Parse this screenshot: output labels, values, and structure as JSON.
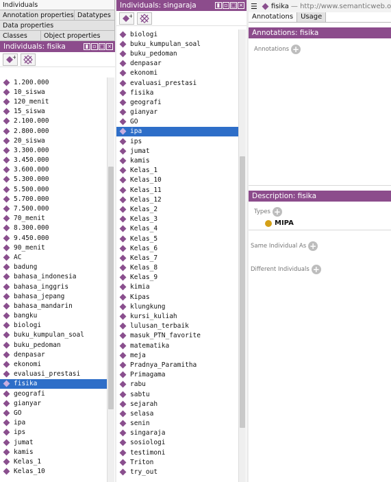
{
  "left_panel": {
    "tabs_row1": [
      "Individuals"
    ],
    "tabs_row2": [
      "Annotation properties",
      "Datatypes"
    ],
    "tabs_row3": [
      "Data properties"
    ],
    "tabs_row4": [
      "Classes",
      "Object properties"
    ],
    "header": "Individuals: fisika",
    "items": [
      "1.200.000",
      "10_siswa",
      "120_menit",
      "15_siswa",
      "2.100.000",
      "2.800.000",
      "20_siswa",
      "3.300.000",
      "3.450.000",
      "3.600.000",
      "5.300.000",
      "5.500.000",
      "5.700.000",
      "7.500.000",
      "70_menit",
      "8.300.000",
      "9.450.000",
      "90_menit",
      "AC",
      "badung",
      "bahasa_indonesia",
      "bahasa_inggris",
      "bahasa_jepang",
      "bahasa_mandarin",
      "bangku",
      "biologi",
      "buku_kumpulan_soal",
      "buku_pedoman",
      "denpasar",
      "ekonomi",
      "evaluasi_prestasi",
      "fisika",
      "geografi",
      "gianyar",
      "GO",
      "ipa",
      "ips",
      "jumat",
      "kamis",
      "Kelas_1",
      "Kelas_10"
    ],
    "selected": "fisika",
    "scroll_position": 0.55
  },
  "middle_panel": {
    "header": "Individuals: singaraja",
    "items": [
      "biologi",
      "buku_kumpulan_soal",
      "buku_pedoman",
      "denpasar",
      "ekonomi",
      "evaluasi_prestasi",
      "fisika",
      "geografi",
      "gianyar",
      "GO",
      "ipa",
      "ips",
      "jumat",
      "kamis",
      "Kelas_1",
      "Kelas_10",
      "Kelas_11",
      "Kelas_12",
      "Kelas_2",
      "Kelas_3",
      "Kelas_4",
      "Kelas_5",
      "Kelas_6",
      "Kelas_7",
      "Kelas_8",
      "Kelas_9",
      "kimia",
      "Kipas",
      "klungkung",
      "kursi_kuliah",
      "lulusan_terbaik",
      "masuk_PTN_favorite",
      "matematika",
      "meja",
      "Pradnya_Paramitha",
      "Primagama",
      "rabu",
      "sabtu",
      "sejarah",
      "selasa",
      "senin",
      "singaraja",
      "sosiologi",
      "testimoni",
      "Triton",
      "try_out"
    ],
    "selected": "ipa",
    "scroll_position": 0.7
  },
  "right_panel": {
    "title": "fisika",
    "title_url": "— http://www.semanticweb.org/u",
    "tabs": [
      "Annotations",
      "Usage"
    ],
    "annotations_header": "Annotations: fisika",
    "annotations_label": "Annotations",
    "description_header": "Description: fisika",
    "types_label": "Types",
    "type_value": "MIPA",
    "same_individual_label": "Same Individual As",
    "different_individuals_label": "Different Individuals"
  },
  "icons": [
    "add-individual-icon",
    "delete-individual-icon",
    "diamond-icon",
    "class-circle-icon",
    "plus-icon",
    "hamburger-icon"
  ],
  "colors": {
    "header": "#8c4c8c",
    "selection": "#2e6ec8",
    "individual": "#8a4f8e",
    "class": "#d4a017"
  }
}
